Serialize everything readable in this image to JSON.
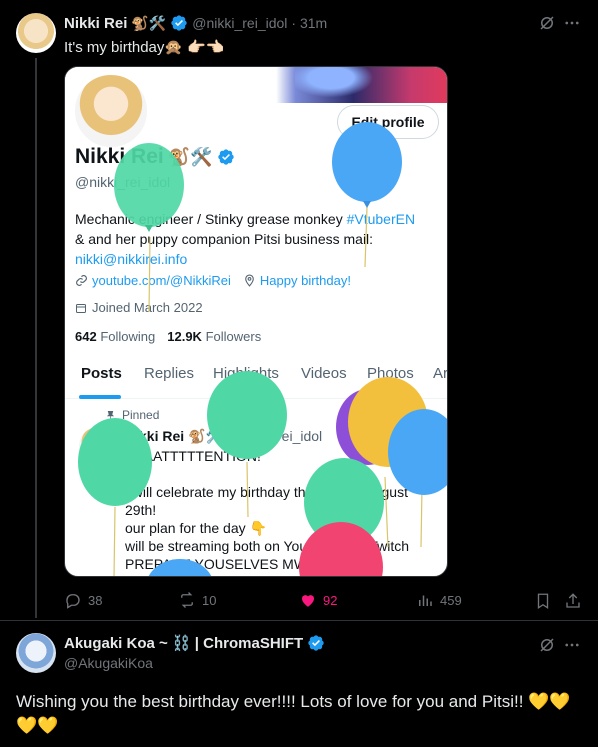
{
  "tweet1": {
    "author_name": "Nikki Rei",
    "author_emojis": "🐒🛠️",
    "handle": "@nikki_rei_idol",
    "time": "· 31m",
    "text": "It's my birthday🙊 👉🏻👈🏻",
    "actions": {
      "replies": "38",
      "retweets": "10",
      "likes": "92",
      "views": "459"
    }
  },
  "card": {
    "edit_profile": "Edit profile",
    "name": "Nikki Rei",
    "name_emojis": "🐒🛠️",
    "handle": "@nikki_rei_idol",
    "bio_line1_prefix": "Mechanic engineer / Stinky grease monkey ",
    "bio_hashtag": "#VtuberEN",
    "bio_line2": "& and her puppy companion Pitsi business mail:",
    "bio_email": "nikki@nikkirei.info",
    "link": "youtube.com/@NikkiRei",
    "location": "Happy birthday!",
    "joined": "Joined March 2022",
    "following_count": "642",
    "following_label": "Following",
    "followers_count": "12.9K",
    "followers_label": "Followers",
    "tabs": [
      "Posts",
      "Replies",
      "Highlights",
      "Videos",
      "Photos",
      "Ar"
    ],
    "pinned_label": "Pinned",
    "pinned_name": "Nikki Rei",
    "pinned_emojis": "🐒🛠️",
    "pinned_handle": "@nikki_rei_idol",
    "pinned_text": [
      "AAAATTTTTENTION!",
      "",
      "I will celebrate my birthday this Friday, August",
      "29th!",
      "our plan for the day 👇",
      "will be streaming both on YouTube and Twitch",
      "PREPARE YOUSELVES MWA"
    ]
  },
  "tweet2": {
    "author_name": "Akugaki Koa ~ ⛓️ | ChromaSHIFT",
    "handle": "@AkugakiKoa",
    "text_line1": "Wishing you the best birthday ever!!!! Lots of love for you and Pitsi!! 💛💛",
    "text_line2": "💛💛"
  },
  "colors": {
    "background": "#000000",
    "accent": "#1d9bf0",
    "like": "#f91880",
    "muted": "#71767b"
  }
}
